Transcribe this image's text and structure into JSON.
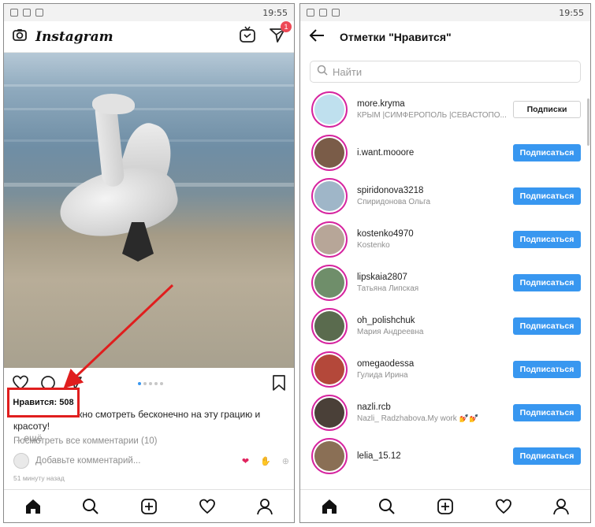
{
  "left_phone": {
    "status_time": "19:55",
    "app_title": "Instagram",
    "dm_badge": "1",
    "likes_label": "Нравится: 508",
    "caption_user": "mor",
    "caption_text": "Можно смотреть бесконечно на эту грацию и красоту!",
    "caption_more": "... ещё",
    "view_all_comments": "Посмотреть все комментарии (10)",
    "add_comment_placeholder": "Добавьте комментарий...",
    "time_ago": "51 минуту назад"
  },
  "right_phone": {
    "status_time": "19:55",
    "title": "Отметки \"Нравится\"",
    "search_placeholder": "Найти",
    "users": [
      {
        "username": "more.kryma",
        "fullname": "КРЫМ |СИМФЕРОПОЛЬ |СЕВАСТОПО...",
        "button": "Подписки",
        "following": true,
        "avatar_color": "#bfe0ee"
      },
      {
        "username": "i.want.mooore",
        "fullname": "",
        "button": "Подписаться",
        "following": false,
        "avatar_color": "#7a5c48"
      },
      {
        "username": "spiridonova3218",
        "fullname": "Спиридонова Ольга",
        "button": "Подписаться",
        "following": false,
        "avatar_color": "#9fb6c8"
      },
      {
        "username": "kostenko4970",
        "fullname": "Kostenko",
        "button": "Подписаться",
        "following": false,
        "avatar_color": "#b7a698"
      },
      {
        "username": "lipskaia2807",
        "fullname": "Татьяна Липская",
        "button": "Подписаться",
        "following": false,
        "avatar_color": "#6f8e6a"
      },
      {
        "username": "oh_polishchuk",
        "fullname": "Мария Андреевна",
        "button": "Подписаться",
        "following": false,
        "avatar_color": "#5a6b4e"
      },
      {
        "username": "omegaodessa",
        "fullname": "Гулида Ирина",
        "button": "Подписаться",
        "following": false,
        "avatar_color": "#b4483a"
      },
      {
        "username": "nazli.rcb",
        "fullname": "Nazli_ Radzhabova.My work 💅💅",
        "button": "Подписаться",
        "following": false,
        "avatar_color": "#4a4038"
      },
      {
        "username": "lelia_15.12",
        "fullname": "",
        "button": "Подписаться",
        "following": false,
        "avatar_color": "#8a6f55"
      }
    ]
  },
  "colors": {
    "accent": "#3897f0",
    "highlight": "#e01e1e",
    "badge": "#ed4956"
  }
}
